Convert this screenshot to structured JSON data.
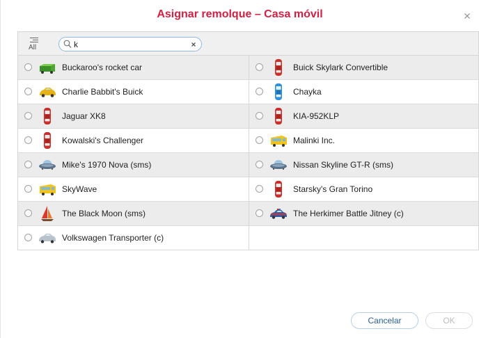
{
  "dialog": {
    "title": "Asignar remolque – Casa móvil",
    "title_color": "#d21f43"
  },
  "toolbar": {
    "all_label": "All",
    "search": {
      "value": "k",
      "placeholder": ""
    }
  },
  "units": [
    {
      "name": "Buckaroo's rocket car",
      "icon": "green-truck-icon"
    },
    {
      "name": "Buick Skylark Convertible",
      "icon": "red-car-top-icon"
    },
    {
      "name": "Charlie Babbit's Buick",
      "icon": "yellow-car-icon"
    },
    {
      "name": "Chayka",
      "icon": "blue-car-top-icon"
    },
    {
      "name": "Jaguar XK8",
      "icon": "red-car-top-icon"
    },
    {
      "name": "KIA-952KLP",
      "icon": "red-car-top-icon"
    },
    {
      "name": "Kowalski's Challenger",
      "icon": "red-car-top-icon"
    },
    {
      "name": "Malinki Inc.",
      "icon": "yellow-bus-icon"
    },
    {
      "name": "Mike's 1970 Nova (sms)",
      "icon": "ufo-icon"
    },
    {
      "name": "Nissan Skyline GT-R (sms)",
      "icon": "ufo-icon"
    },
    {
      "name": "SkyWave",
      "icon": "yellow-bus-icon"
    },
    {
      "name": "Starsky's Gran Torino",
      "icon": "red-car-top-icon"
    },
    {
      "name": "The Black Moon (sms)",
      "icon": "sailboat-icon"
    },
    {
      "name": "The Herkimer Battle Jitney (c)",
      "icon": "police-car-icon"
    },
    {
      "name": "Volkswagen Transporter (c)",
      "icon": "silver-car-icon"
    }
  ],
  "footer": {
    "cancel_label": "Cancelar",
    "ok_label": "OK"
  }
}
